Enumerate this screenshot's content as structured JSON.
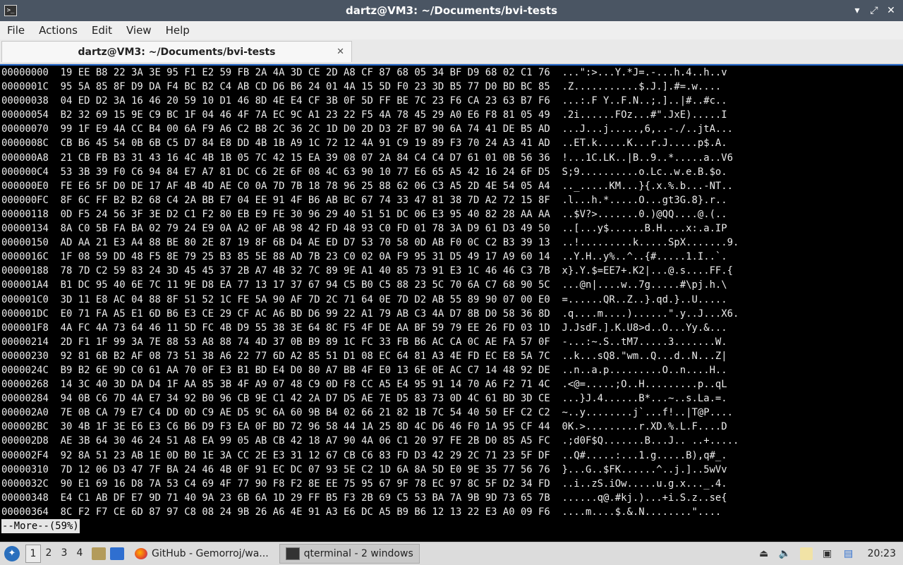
{
  "window": {
    "title": "dartz@VM3: ~/Documents/bvi-tests",
    "minimize_glyph": "▾",
    "maximize_glyph": "⤢",
    "close_glyph": "✕"
  },
  "menu": [
    "File",
    "Actions",
    "Edit",
    "View",
    "Help"
  ],
  "tab": {
    "label": "dartz@VM3: ~/Documents/bvi-tests",
    "close_glyph": "✕"
  },
  "terminal": {
    "rows": [
      {
        "offset": "00000000",
        "hex": "19 EE B8 22 3A 3E 95 F1 E2 59 FB 2A 4A 3D CE 2D A8 CF 87 68 05 34 BF D9 68 02 C1 76",
        "ascii": "...\":>...Y.*J=.-...h.4..h..v"
      },
      {
        "offset": "0000001C",
        "hex": "95 5A 85 8F D9 DA F4 BC B2 C4 AB CD D6 B6 24 01 4A 15 5D F0 23 3D B5 77 D0 BD BC 85",
        "ascii": ".Z...........$.J.].#=.w...."
      },
      {
        "offset": "00000038",
        "hex": "04 ED D2 3A 16 46 20 59 10 D1 46 8D 4E E4 CF 3B 0F 5D FF BE 7C 23 F6 CA 23 63 B7 F6",
        "ascii": "...:.F Y..F.N..;.]..|#..#c.."
      },
      {
        "offset": "00000054",
        "hex": "B2 32 69 15 9E C9 BC 1F 04 46 4F 7A EC 9C A1 23 22 F5 4A 78 45 29 A0 E6 F8 81 05 49",
        "ascii": ".2i......FOz...#\".JxE).....I"
      },
      {
        "offset": "00000070",
        "hex": "99 1F E9 4A CC B4 00 6A F9 A6 C2 B8 2C 36 2C 1D D0 2D D3 2F B7 90 6A 74 41 DE B5 AD",
        "ascii": "...J...j.....,6,..-./..jtA..."
      },
      {
        "offset": "0000008C",
        "hex": "CB B6 45 54 0B 6B C5 D7 84 E8 DD 4B 1B A9 1C 72 12 4A 91 C9 19 89 F3 70 24 A3 41 AD",
        "ascii": "..ET.k.....K...r.J.....p$.A."
      },
      {
        "offset": "000000A8",
        "hex": "21 CB FB B3 31 43 16 4C 4B 1B 05 7C 42 15 EA 39 08 07 2A 84 C4 C4 D7 61 01 0B 56 36",
        "ascii": "!...1C.LK..|B..9..*.....a..V6"
      },
      {
        "offset": "000000C4",
        "hex": "53 3B 39 F0 C6 94 84 E7 A7 81 DC C6 2E 6F 08 4C 63 90 10 77 E6 65 A5 42 16 24 6F D5",
        "ascii": "S;9..........o.Lc..w.e.B.$o."
      },
      {
        "offset": "000000E0",
        "hex": "FE E6 5F D0 DE 17 AF 4B 4D AE C0 0A 7D 7B 18 78 96 25 88 62 06 C3 A5 2D 4E 54 05 A4",
        "ascii": ".._.....KM...}{.x.%.b...-NT.."
      },
      {
        "offset": "000000FC",
        "hex": "8F 6C FF B2 B2 68 C4 2A BB E7 04 EE 91 4F B6 AB BC 67 74 33 47 81 38 7D A2 72 15 8F",
        "ascii": ".l...h.*.....O...gt3G.8}.r.."
      },
      {
        "offset": "00000118",
        "hex": "0D F5 24 56 3F 3E D2 C1 F2 80 EB E9 FE 30 96 29 40 51 51 DC 06 E3 95 40 82 28 AA AA",
        "ascii": "..$V?>.......0.)@QQ....@.(.."
      },
      {
        "offset": "00000134",
        "hex": "8A C0 5B FA BA 02 79 24 E9 0A A2 0F AB 98 42 FD 48 93 C0 FD 01 78 3A D9 61 D3 49 50",
        "ascii": "..[...y$......B.H....x:.a.IP"
      },
      {
        "offset": "00000150",
        "hex": "AD AA 21 E3 A4 88 BE 80 2E 87 19 8F 6B D4 AE ED D7 53 70 58 0D AB F0 0C C2 B3 39 13",
        "ascii": "..!.........k.....SpX.......9."
      },
      {
        "offset": "0000016C",
        "hex": "1F 08 59 DD 48 F5 8E 79 25 B3 85 5E 88 AD 7B 23 C0 02 0A F9 95 31 D5 49 17 A9 60 14",
        "ascii": "..Y.H..y%..^..{#.....1.I..`."
      },
      {
        "offset": "00000188",
        "hex": "78 7D C2 59 83 24 3D 45 45 37 2B A7 4B 32 7C 89 9E A1 40 85 73 91 E3 1C 46 46 C3 7B",
        "ascii": "x}.Y.$=EE7+.K2|...@.s....FF.{"
      },
      {
        "offset": "000001A4",
        "hex": "B1 DC 95 40 6E 7C 11 9E D8 EA 77 13 17 37 67 94 C5 B0 C5 88 23 5C 70 6A C7 68 90 5C",
        "ascii": "...@n|....w..7g.....#\\pj.h.\\"
      },
      {
        "offset": "000001C0",
        "hex": "3D 11 E8 AC 04 88 8F 51 52 1C FE 5A 90 AF 7D 2C 71 64 0E 7D D2 AB 55 89 90 07 00 E0",
        "ascii": "=......QR..Z..}.qd.}..U....."
      },
      {
        "offset": "000001DC",
        "hex": "E0 71 FA A5 E1 6D B6 E3 CE 29 CF AC A6 BD D6 99 22 A1 79 AB C3 4A D7 8B D0 58 36 8D",
        "ascii": ".q....m....)......\".y..J...X6."
      },
      {
        "offset": "000001F8",
        "hex": "4A FC 4A 73 64 46 11 5D FC 4B D9 55 38 3E 64 8C F5 4F DE AA BF 59 79 EE 26 FD 03 1D",
        "ascii": "J.JsdF.].K.U8>d..O...Yy.&..."
      },
      {
        "offset": "00000214",
        "hex": "2D F1 1F 99 3A 7E 88 53 A8 88 74 4D 37 0B B9 89 1C FC 33 FB B6 AC CA 0C AE FA 57 0F",
        "ascii": "-...:~.S..tM7.....3.......W."
      },
      {
        "offset": "00000230",
        "hex": "92 81 6B B2 AF 08 73 51 38 A6 22 77 6D A2 85 51 D1 08 EC 64 81 A3 4E FD EC E8 5A 7C",
        "ascii": "..k...sQ8.\"wm..Q...d..N...Z|"
      },
      {
        "offset": "0000024C",
        "hex": "B9 B2 6E 9D C0 61 AA 70 0F E3 B1 BD E4 D0 80 A7 BB 4F E0 13 6E 0E AC C7 14 48 92 DE",
        "ascii": "..n..a.p.........O..n....H.."
      },
      {
        "offset": "00000268",
        "hex": "14 3C 40 3D DA D4 1F AA 85 3B 4F A9 07 48 C9 0D F8 CC A5 E4 95 91 14 70 A6 F2 71 4C",
        "ascii": ".<@=.....;O..H.........p..qL"
      },
      {
        "offset": "00000284",
        "hex": "94 0B C6 7D 4A E7 34 92 B0 96 CB 9E C1 42 2A D7 D5 AE 7E D5 83 73 0D 4C 61 BD 3D CE",
        "ascii": "...}J.4......B*...~..s.La.=."
      },
      {
        "offset": "000002A0",
        "hex": "7E 0B CA 79 E7 C4 DD 0D C9 AE D5 9C 6A 60 9B B4 02 66 21 82 1B 7C 54 40 50 EF C2 C2",
        "ascii": "~..y........j`...f!..|T@P...."
      },
      {
        "offset": "000002BC",
        "hex": "30 4B 1F 3E E6 E3 C6 B6 D9 F3 EA 0F BD 72 96 58 44 1A 25 8D 4C D6 46 F0 1A 95 CF 44",
        "ascii": "0K.>.........r.XD.%.L.F....D"
      },
      {
        "offset": "000002D8",
        "hex": "AE 3B 64 30 46 24 51 A8 EA 99 05 AB CB 42 18 A7 90 4A 06 C1 20 97 FE 2B D0 85 A5 FC",
        "ascii": ".;d0F$Q.......B...J.. ..+....."
      },
      {
        "offset": "000002F4",
        "hex": "92 8A 51 23 AB 1E 0D B0 1E 3A CC 2E E3 31 12 67 CB C6 83 FD D3 42 29 2C 71 23 5F DF",
        "ascii": "..Q#.....:...1.g.....B),q#_."
      },
      {
        "offset": "00000310",
        "hex": "7D 12 06 D3 47 7F BA 24 46 4B 0F 91 EC DC 07 93 5E C2 1D 6A 8A 5D E0 9E 35 77 56 76",
        "ascii": "}...G..$FK......^..j.]..5wVv"
      },
      {
        "offset": "0000032C",
        "hex": "90 E1 69 16 D8 7A 53 C4 69 4F 77 90 F8 F2 8E EE 75 95 67 9F 78 EC 97 8C 5F D2 34 FD",
        "ascii": "..i..zS.iOw.....u.g.x..._.4."
      },
      {
        "offset": "00000348",
        "hex": "E4 C1 AB DF E7 9D 71 40 9A 23 6B 6A 1D 29 FF B5 F3 2B 69 C5 53 BA 7A 9B 9D 73 65 7B",
        "ascii": "......q@.#kj.)...+i.S.z..se{"
      },
      {
        "offset": "00000364",
        "hex": "8C F2 F7 CE 6D 87 97 C8 08 24 9B 26 A6 4E 91 A3 E6 DC A5 B9 B6 12 13 22 E3 A0 09 F6",
        "ascii": "....m....$.&.N........\"...."
      }
    ],
    "pager_prompt": "--More--(59%)"
  },
  "taskbar": {
    "desktops": [
      "1",
      "2",
      "3",
      "4"
    ],
    "tasks": [
      {
        "label": "GitHub - Gemorroj/wa...",
        "icon": "firefox-icon"
      },
      {
        "label": "qterminal - 2 windows",
        "icon": "terminal-icon"
      }
    ],
    "clock": "20:23"
  },
  "colors": {
    "titlebar": "#4a5563",
    "terminal_bg": "#000000",
    "terminal_fg": "#ececec",
    "accent": "#1f63c8"
  }
}
